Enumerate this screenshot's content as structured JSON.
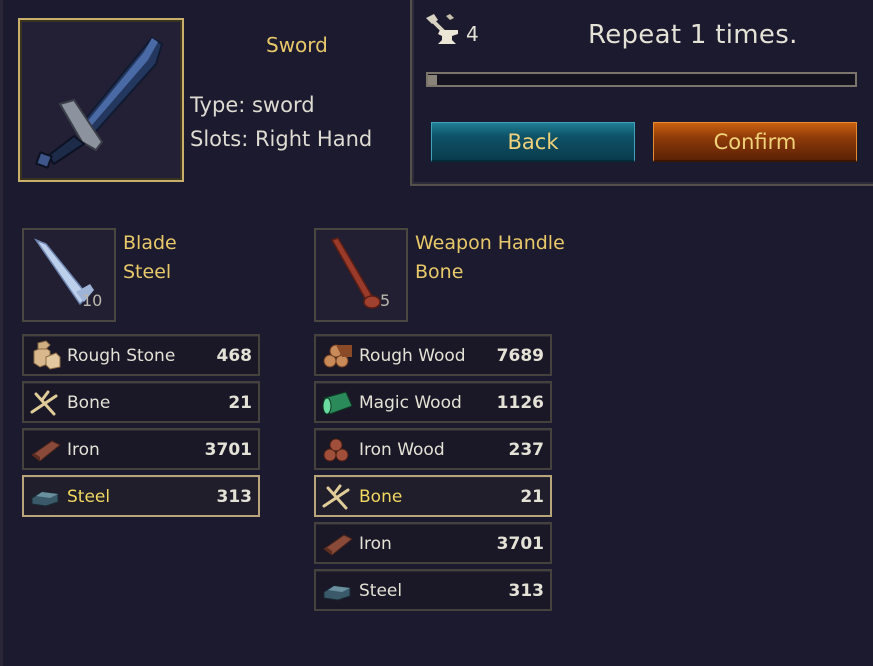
{
  "item": {
    "title": "Sword",
    "type_text": "Type: sword",
    "slots_text": "Slots: Right Hand"
  },
  "craft": {
    "count": "4",
    "repeat_text": "Repeat 1 times.",
    "slider_fraction": 0.0,
    "back_label": "Back",
    "confirm_label": "Confirm"
  },
  "components": [
    {
      "name": "Blade",
      "material": "Steel",
      "count": "10",
      "icon": "blade-icon",
      "materials": [
        {
          "name": "Rough Stone",
          "qty": "468",
          "icon": "rough-stone-icon",
          "selected": false
        },
        {
          "name": "Bone",
          "qty": "21",
          "icon": "bone-icon",
          "selected": false
        },
        {
          "name": "Iron",
          "qty": "3701",
          "icon": "iron-icon",
          "selected": false
        },
        {
          "name": "Steel",
          "qty": "313",
          "icon": "steel-icon",
          "selected": true
        }
      ]
    },
    {
      "name": "Weapon Handle",
      "material": "Bone",
      "count": "5",
      "icon": "handle-icon",
      "materials": [
        {
          "name": "Rough Wood",
          "qty": "7689",
          "icon": "rough-wood-icon",
          "selected": false
        },
        {
          "name": "Magic Wood",
          "qty": "1126",
          "icon": "magic-wood-icon",
          "selected": false
        },
        {
          "name": "Iron Wood",
          "qty": "237",
          "icon": "iron-wood-icon",
          "selected": false
        },
        {
          "name": "Bone",
          "qty": "21",
          "icon": "bone-icon",
          "selected": true
        },
        {
          "name": "Iron",
          "qty": "3701",
          "icon": "iron-icon",
          "selected": false
        },
        {
          "name": "Steel",
          "qty": "313",
          "icon": "steel-icon",
          "selected": false
        }
      ]
    }
  ],
  "colors": {
    "background": "#1c1a2e",
    "gold_text": "#e8c96a",
    "selected_text": "#f2d860",
    "back_button": "#0e5368",
    "confirm_button": "#8e3a09"
  }
}
